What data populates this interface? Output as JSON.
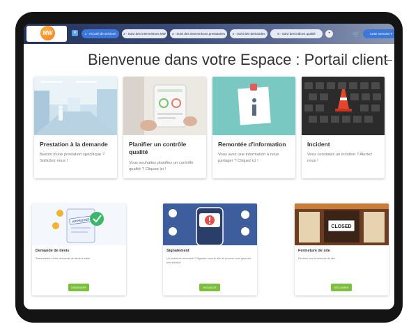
{
  "logo": {
    "text": "MW"
  },
  "nav": {
    "menu_icon": "menu-icon",
    "tabs": [
      {
        "label": "1 - Accueil de services",
        "active": true
      },
      {
        "label": "2 - Suivi des interventions MW",
        "active": false
      },
      {
        "label": "3 - Suivi des interventions prestataires",
        "active": false
      },
      {
        "label": "4 - Suivi des demandes",
        "active": false
      },
      {
        "label": "5 - Suivi des indices qualité",
        "active": false
      }
    ],
    "more": "•",
    "cart_icon": "cart-icon",
    "week_label": "Cette semaine ▾"
  },
  "page_title": "Bienvenue dans votre Espace : Portail client",
  "cards": [
    {
      "title": "Prestation à la demande",
      "text": "Besoin d'une prestation spécifique ? Sollicitez nous !"
    },
    {
      "title": "Planifier un contrôle qualité",
      "text": "Vous souhaitez planifiez un contrôle qualité ? Cliquez ici !"
    },
    {
      "title": "Remontée d'information",
      "text": "Vous avez une information à nous partager ? Cliquez ici !"
    },
    {
      "title": "Incident",
      "text": "Vous constatez un incident ? Alertez nous !"
    }
  ],
  "cards2": [
    {
      "title": "Demande de devis",
      "text": "Transmission d'une demande de devis à traiter",
      "button": "DEMANDER",
      "image_text": "APPROVED"
    },
    {
      "title": "Signalement",
      "text": "Un problème rencontré ? Signalez nous le afin de pouvoir vous apporter une solution",
      "button": "SIGNALER"
    },
    {
      "title": "Fermeture de site",
      "text": "Déclarer vos fermetures de site",
      "button": "DÉCLARER",
      "image_text": "CLOSED"
    }
  ],
  "colors": {
    "accent": "#3c78d8",
    "action": "#7cbf3c",
    "logo": "#f07b1d"
  }
}
